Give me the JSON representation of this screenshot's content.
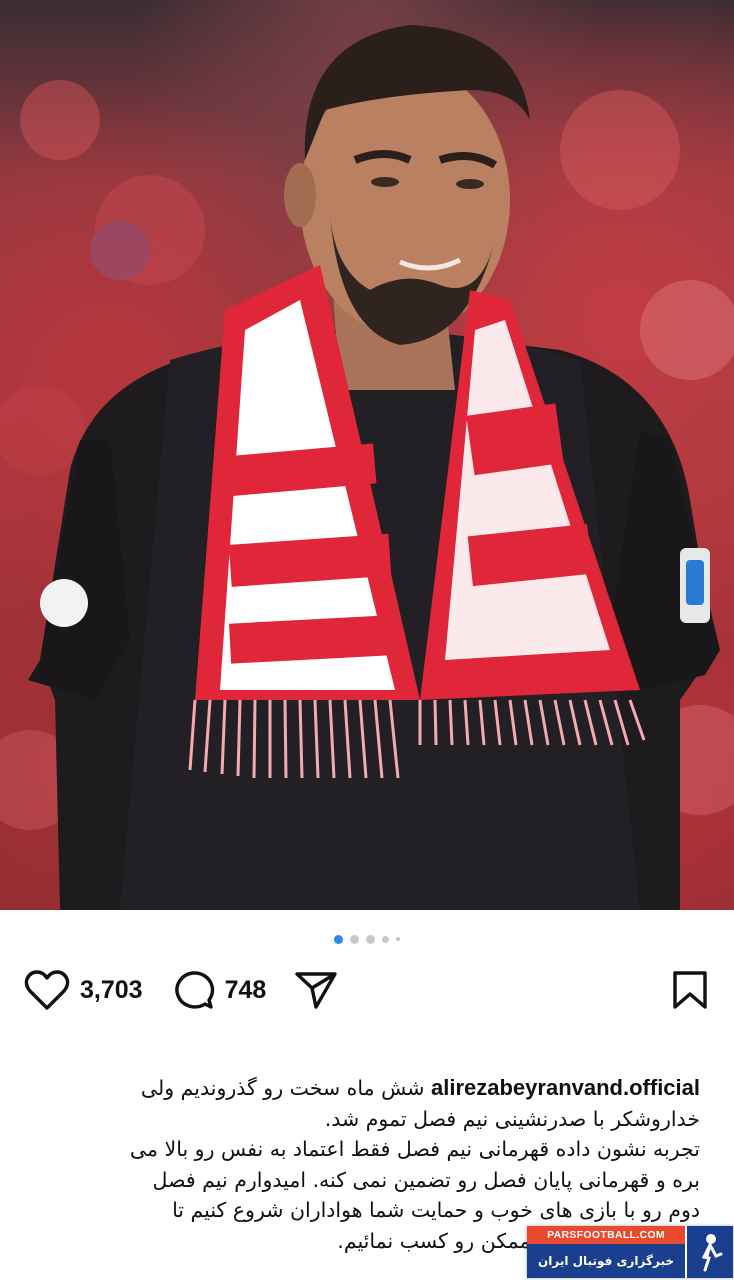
{
  "post": {
    "image_description_icon": "player-photo",
    "carousel": {
      "total_dots": 5,
      "active_index": 0
    },
    "likes_count": "3,703",
    "comments_count": "748",
    "icons": {
      "like": "heart-icon",
      "comment": "comment-bubble-icon",
      "share": "paper-plane-icon",
      "save": "bookmark-icon"
    }
  },
  "caption": {
    "username": "alirezabeyranvand.official",
    "lines": [
      "شش ماه سخت رو گذروندیم ولی",
      "خداروشکر با صدرنشینی نیم فصل تموم شد.",
      "تجربه نشون داده قهرمانی نیم فصل فقط اعتماد به نفس رو بالا می",
      "بره و قهرمانی پایان فصل رو تضمین نمی کنه. امیدوارم نیم فصل",
      "دوم رو با بازی های خوب و حمایت شما هواداران شروع کنیم تا",
      "بتوانیم بهترین نتیجه ممکن رو کسب نمائیم."
    ]
  },
  "watermark": {
    "site": "PARSFOOTBALL.COM",
    "tagline": "خبرگزاری فوتبال ایران"
  },
  "colors": {
    "accent_blue": "#2f86e8",
    "scarf_red": "#e0273a",
    "watermark_orange": "#e94a2d",
    "watermark_blue": "#1a3f8f"
  }
}
